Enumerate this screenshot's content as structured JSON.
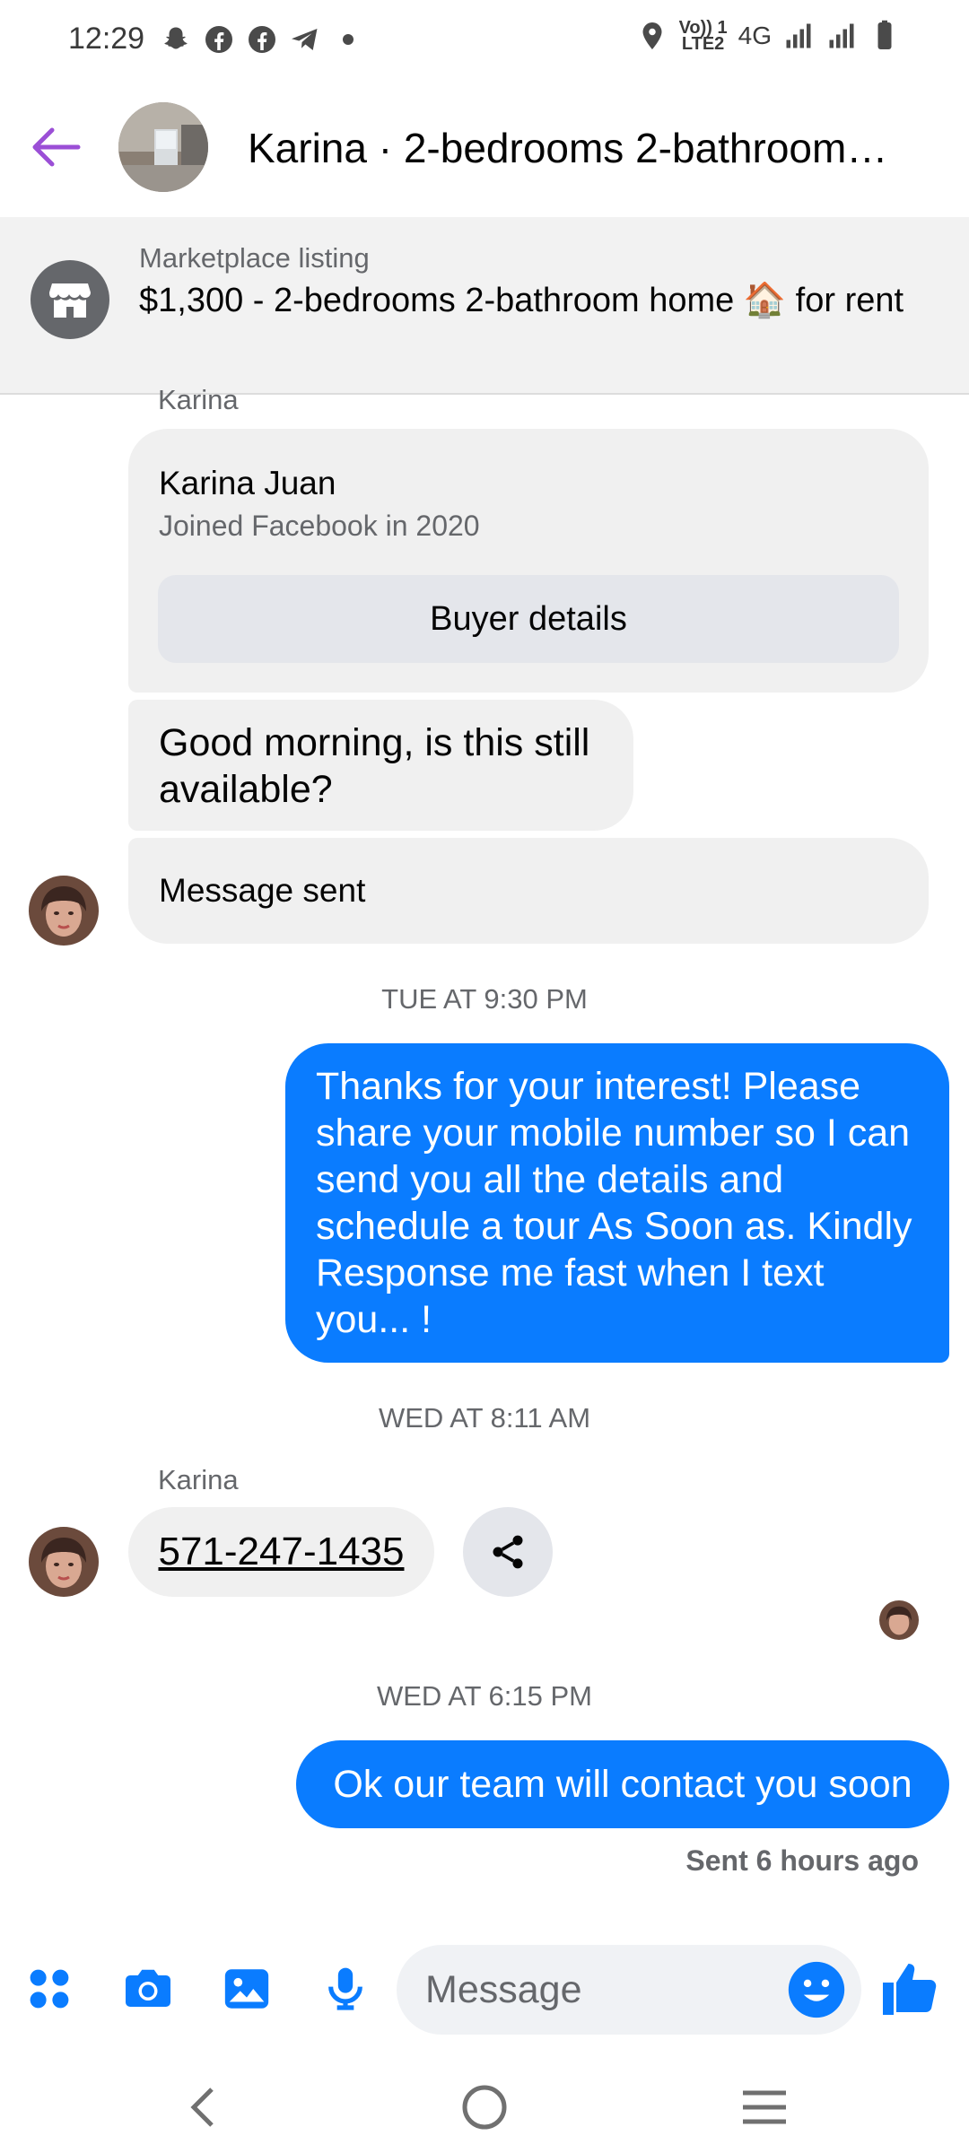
{
  "status_bar": {
    "time": "12:29",
    "left_icons": [
      "snapchat-icon",
      "facebook-icon",
      "facebook-icon",
      "telegram-icon",
      "dot-icon"
    ],
    "network_line1": "Vo)) 1",
    "network_line2": "LTE2",
    "network_type": "4G",
    "right_icons": [
      "location-icon",
      "signal-icon",
      "signal-icon",
      "battery-icon"
    ]
  },
  "header": {
    "title": "Karina · 2-bedrooms 2-bathroom…",
    "accent_color": "#9b4fd6"
  },
  "listing": {
    "kicker": "Marketplace listing",
    "title": "$1,300 - 2-bedrooms 2-bathroom home 🏠 for rent",
    "icon": "marketplace-store-icon"
  },
  "thread": {
    "sender_label_top": "Karina",
    "profile_card": {
      "name": "Karina Juan",
      "subtitle": "Joined Facebook in 2020",
      "button_label": "Buyer details"
    },
    "msg_available": "Good morning, is this still available?",
    "msg_sent_notice": "Message sent",
    "timestamp_1": "TUE AT 9:30 PM",
    "outgoing_1": "Thanks for your interest! Please share your mobile number so I can send you all the details and schedule a tour As Soon as. Kindly Response me fast when I text you... !",
    "timestamp_2": "WED AT 8:11 AM",
    "sender_label_2": "Karina",
    "phone_number": "571-247-1435",
    "timestamp_3": "WED AT 6:15 PM",
    "outgoing_2": "Ok our team will contact you soon",
    "sent_status": "Sent 6 hours ago"
  },
  "composer": {
    "placeholder": "Message",
    "brand_color": "#0a7cff"
  }
}
